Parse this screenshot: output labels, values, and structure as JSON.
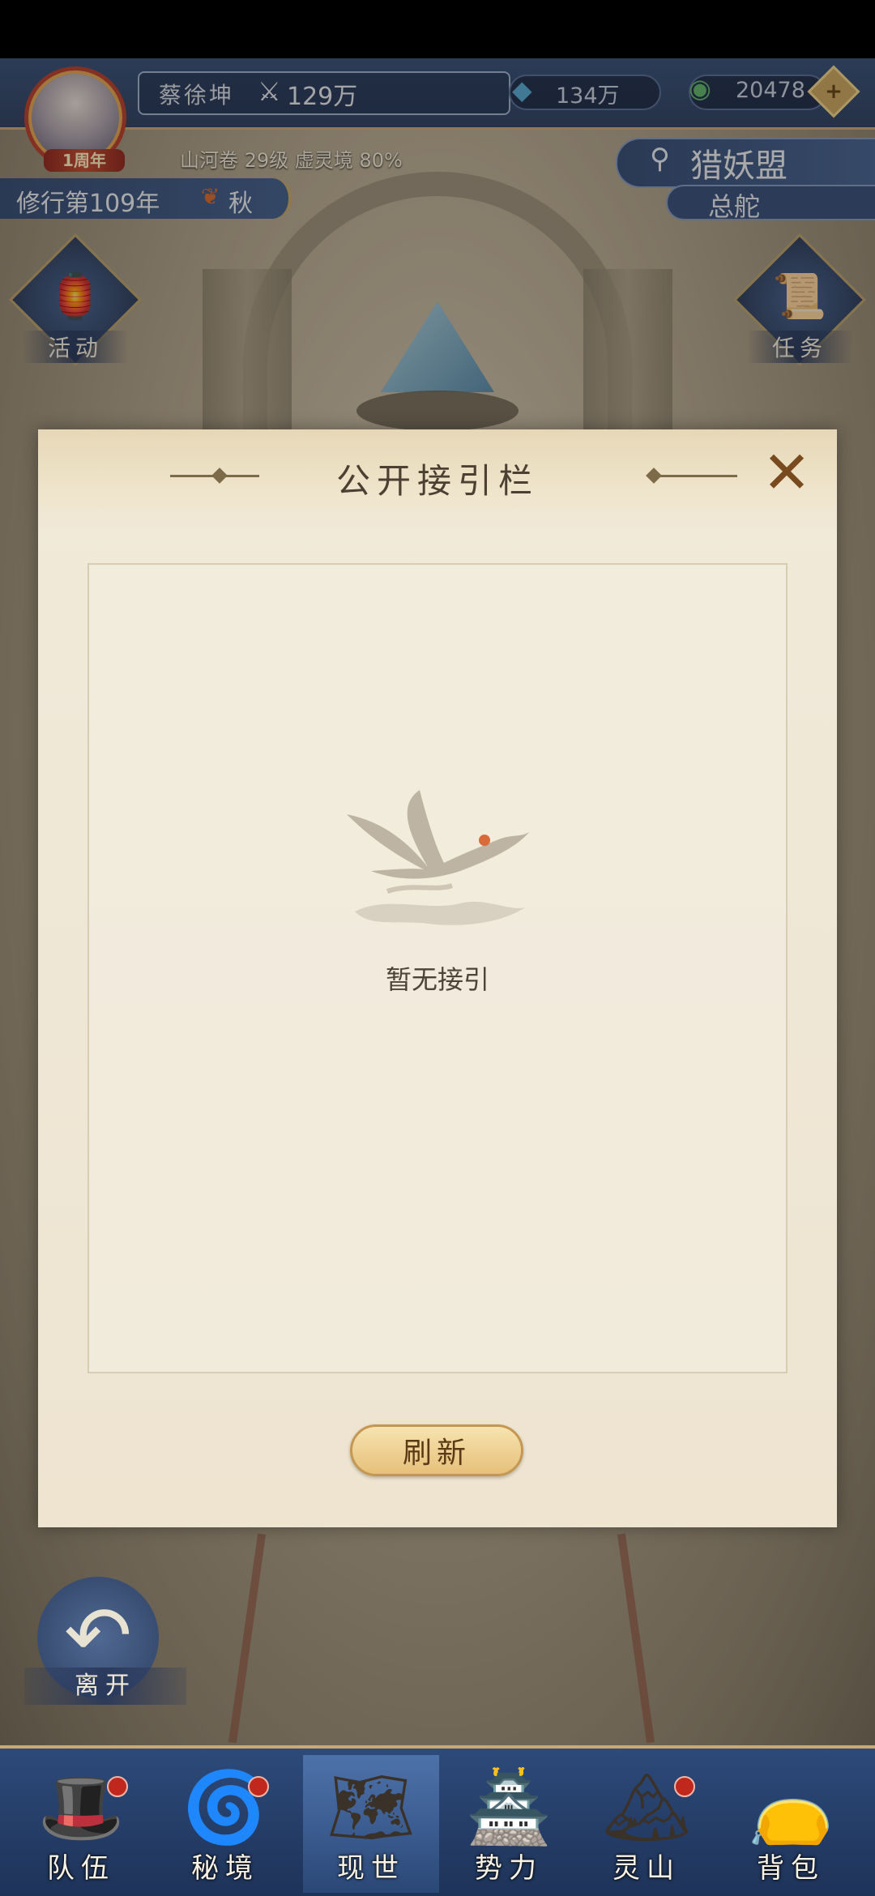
{
  "player": {
    "name": "蔡徐坤",
    "power": "129万",
    "anniversary_badge": "1周年",
    "realm_line": "山河卷 29级 虚灵境 80%",
    "year": "修行第109年",
    "season": "秋"
  },
  "resources": {
    "spirit_stone": "134万",
    "jade": "20478"
  },
  "alliance": {
    "name": "猎妖盟",
    "location": "总舵"
  },
  "side_buttons": {
    "activity": "活动",
    "task": "任务"
  },
  "modal": {
    "title": "公开接引栏",
    "empty_text": "暂无接引",
    "refresh_label": "刷新"
  },
  "leave_label": "离开",
  "bottom_nav": [
    {
      "label": "队伍",
      "icon": "party-icon",
      "badge": true
    },
    {
      "label": "秘境",
      "icon": "portal-icon",
      "badge": true
    },
    {
      "label": "现世",
      "icon": "scroll-map-icon",
      "badge": false,
      "active": true
    },
    {
      "label": "势力",
      "icon": "palace-icon",
      "badge": false
    },
    {
      "label": "灵山",
      "icon": "mountain-icon",
      "badge": true
    },
    {
      "label": "背包",
      "icon": "bag-icon",
      "badge": false
    }
  ]
}
